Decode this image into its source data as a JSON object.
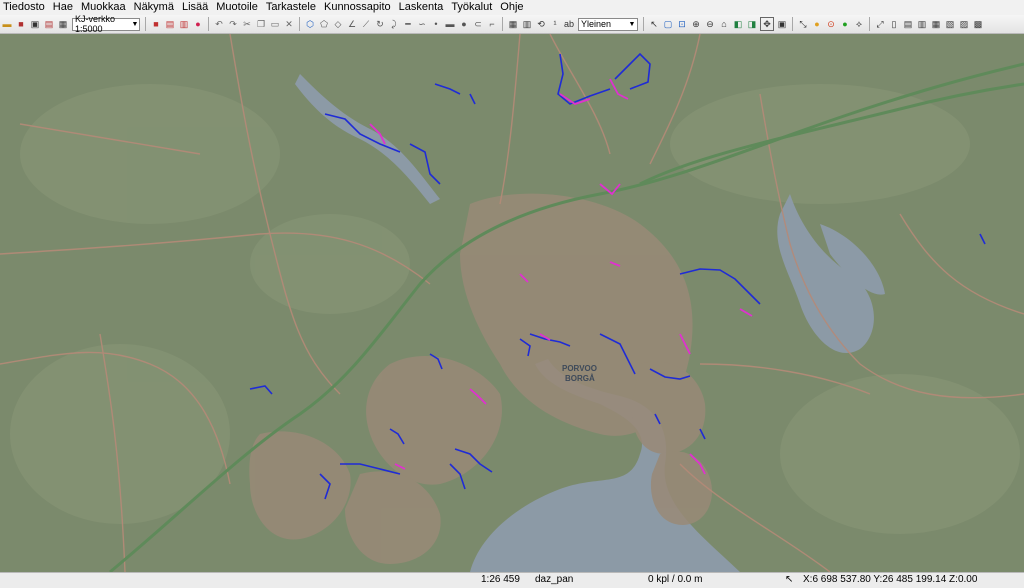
{
  "menu": [
    "Tiedosto",
    "Hae",
    "Muokkaa",
    "Näkymä",
    "Lisää",
    "Muotoile",
    "Tarkastele",
    "Kunnossapito",
    "Laskenta",
    "Työkalut",
    "Ohje"
  ],
  "toolbar": {
    "network_select": "KJ-verkko 1:5000",
    "symbol_select": "Yleinen"
  },
  "map": {
    "place_label_fi": "PORVOO",
    "place_label_sv": "BORGÅ"
  },
  "status": {
    "scale": "1:26 459",
    "tool": "daz_pan",
    "selection": "0 kpl / 0.0 m",
    "coords": "X:6 698 537.80  Y:26 485 199.14  Z:0.00"
  },
  "colors": {
    "land": "#7b8a6c",
    "water": "#8c9aa6",
    "urban": "#9a8a7a",
    "road_major": "#5f8a5a",
    "road": "#b58a78",
    "network_blue": "#1f2bd6",
    "network_magenta": "#e030d0"
  }
}
